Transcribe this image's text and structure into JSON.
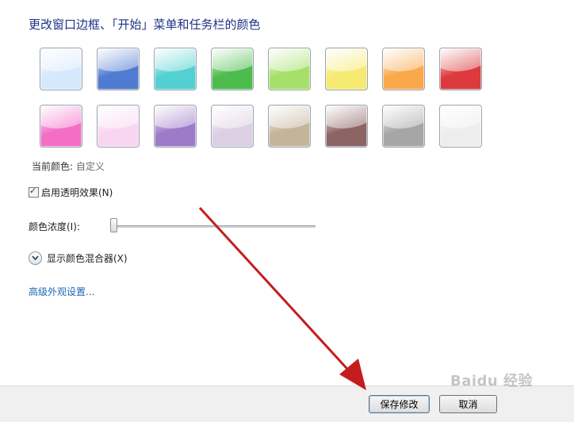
{
  "title": "更改窗口边框、「开始」菜单和任务栏的颜色",
  "swatches": [
    {
      "name": "sky",
      "color": "#d6e8fb"
    },
    {
      "name": "twilight",
      "color": "#4f7bd0"
    },
    {
      "name": "sea",
      "color": "#52d0d2"
    },
    {
      "name": "leaf",
      "color": "#4cbc4c"
    },
    {
      "name": "lime",
      "color": "#a6e06a"
    },
    {
      "name": "lemon",
      "color": "#f6ea72"
    },
    {
      "name": "pumpkin",
      "color": "#f9a84a"
    },
    {
      "name": "ruby",
      "color": "#dc3a3e"
    },
    {
      "name": "fuchsia",
      "color": "#f46ec6"
    },
    {
      "name": "blush",
      "color": "#f8d6f2"
    },
    {
      "name": "violet",
      "color": "#9e7ac8"
    },
    {
      "name": "lavender",
      "color": "#dccfe3"
    },
    {
      "name": "taupe",
      "color": "#c3b49a"
    },
    {
      "name": "chocolate",
      "color": "#8c6464"
    },
    {
      "name": "slate",
      "color": "#a6a6a6"
    },
    {
      "name": "frost",
      "color": "#ededed"
    }
  ],
  "current_color": {
    "label": "当前颜色:",
    "value": "自定义"
  },
  "transparency": {
    "label": "启用透明效果(N)",
    "checked": true
  },
  "intensity": {
    "label": "颜色浓度(I):",
    "value": 0
  },
  "mixer": {
    "label": "显示颜色混合器(X)",
    "icon": "chevron-down-icon"
  },
  "advanced_link": "高级外观设置...",
  "buttons": {
    "save": "保存修改",
    "cancel": "取消"
  },
  "watermark": "Baidu 经验",
  "annotation_arrow_color": "#c41d1d"
}
